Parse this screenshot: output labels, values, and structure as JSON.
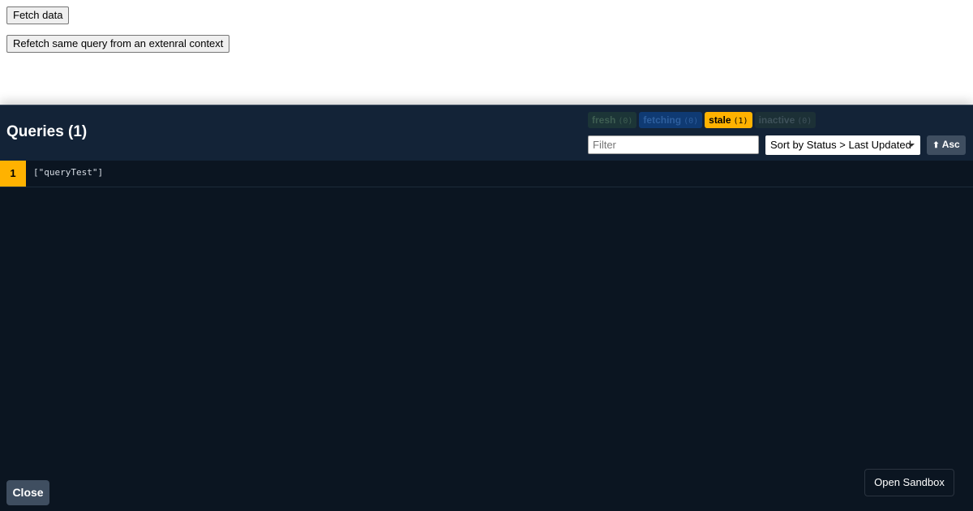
{
  "page": {
    "fetch_button": "Fetch data",
    "refetch_button": "Refetch same query from an extenral context"
  },
  "devtools": {
    "title": "Queries (1)",
    "status_filters": [
      {
        "label": "fresh",
        "count": "(0)",
        "color": "#1c3537"
      },
      {
        "label": "fetching",
        "count": "(0)",
        "color": "#0f3a73"
      },
      {
        "label": "stale",
        "count": "(1)",
        "color": "#ffb200"
      },
      {
        "label": "inactive",
        "count": "(0)",
        "color": "#1c3036"
      }
    ],
    "filter": {
      "placeholder": "Filter",
      "value": ""
    },
    "sort": {
      "selected": "Sort by Status > Last Updated"
    },
    "order_button": {
      "icon": "arrow-up-icon",
      "label": "Asc"
    },
    "queries": [
      {
        "observers": "1",
        "key": "[\"queryTest\"]",
        "status_color": "#ffb200"
      }
    ],
    "close_button": "Close",
    "sandbox_button": "Open Sandbox",
    "colors": {
      "panel_bg": "#0b1521",
      "header_bg": "#132337",
      "accent_stale": "#ffb200",
      "button_bg": "#3f4e60"
    }
  }
}
